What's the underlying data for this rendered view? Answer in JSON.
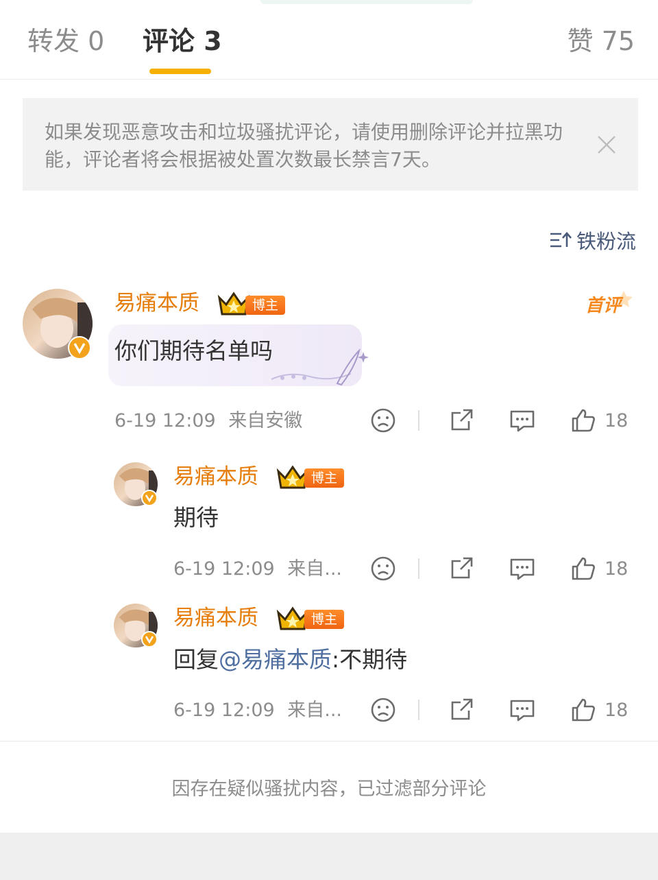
{
  "tabs": {
    "repost": "转发 0",
    "comment": "评论 3",
    "like": "赞 75"
  },
  "notice": {
    "text": "如果发现恶意攻击和垃圾骚扰评论，请使用删除评论并拉黑功能，评论者将会根据被处置次数最长禁言7天。",
    "close_icon": "close-icon"
  },
  "sort": {
    "label": "铁粉流",
    "icon": "sort-icon"
  },
  "first_badge": "首评",
  "comments": [
    {
      "author": "易痛本质",
      "role": "博主",
      "text": "你们期待名单吗",
      "time": "6-19 12:09",
      "location": "来自安徽",
      "likes": "18"
    }
  ],
  "replies": [
    {
      "author": "易痛本质",
      "role": "博主",
      "text": "期待",
      "time": "6-19 12:09",
      "location": "来自...",
      "likes": "18"
    },
    {
      "author": "易痛本质",
      "role": "博主",
      "text_prefix": "回复",
      "mention": "@易痛本质",
      "text_suffix": ":不期待",
      "time": "6-19 12:09",
      "location": "来自...",
      "likes": "18"
    }
  ],
  "filter_note": "因存在疑似骚扰内容，已过滤部分评论",
  "colors": {
    "accent": "#f7b000",
    "name": "#e67e0d",
    "mention": "#4f6fa1",
    "role_badge": "#f06412"
  }
}
